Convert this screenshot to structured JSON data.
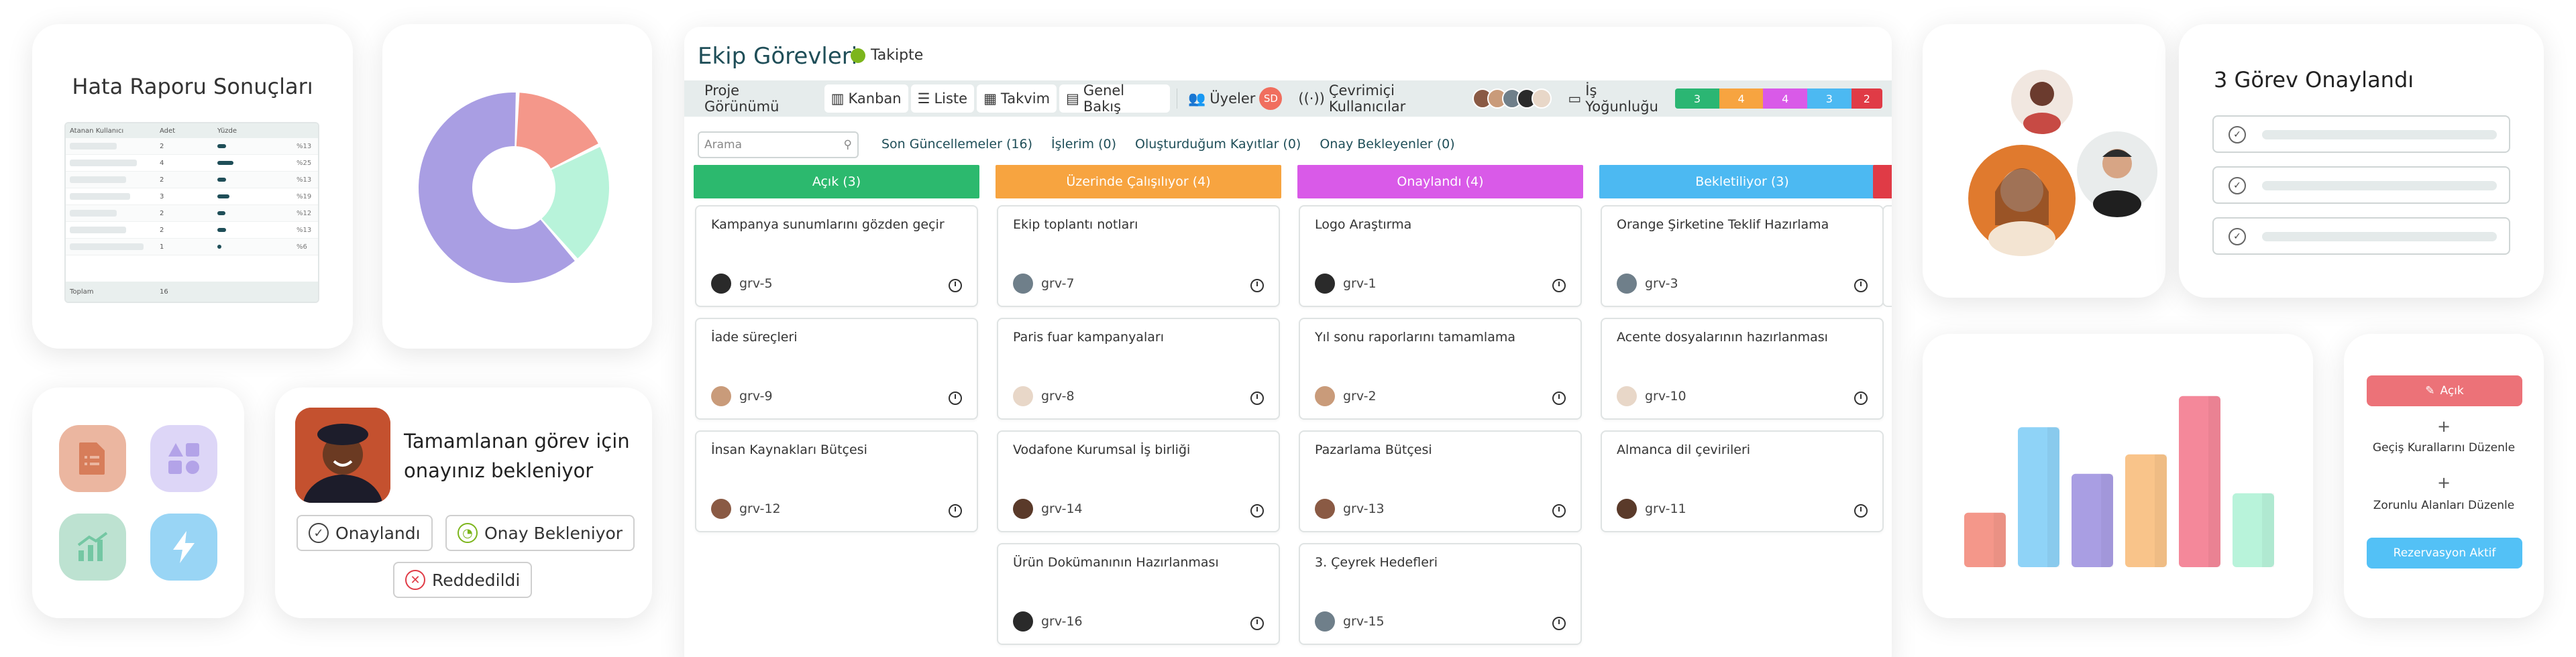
{
  "report": {
    "title": "Hata Raporu Sonuçları",
    "headers": [
      "Atanan Kullanıcı",
      "Adet",
      "Yüzde"
    ],
    "rows": [
      {
        "count": "2",
        "pct": "%13",
        "fill": 0.13
      },
      {
        "count": "4",
        "pct": "%25",
        "fill": 0.25
      },
      {
        "count": "2",
        "pct": "%13",
        "fill": 0.13
      },
      {
        "count": "3",
        "pct": "%19",
        "fill": 0.19
      },
      {
        "count": "2",
        "pct": "%12",
        "fill": 0.12
      },
      {
        "count": "2",
        "pct": "%13",
        "fill": 0.13
      },
      {
        "count": "1",
        "pct": "%6",
        "fill": 0.06
      }
    ],
    "total_label": "Toplam",
    "total_value": "16"
  },
  "donut": {
    "colors": [
      "#a99ee3",
      "#f4978a",
      "#b8f3da"
    ],
    "values": [
      0.62,
      0.17,
      0.21
    ]
  },
  "icons": {
    "items": [
      {
        "name": "document-list-icon",
        "bg": "#ebb6a0",
        "fg": "#d77d5a"
      },
      {
        "name": "shapes-icon",
        "bg": "#ddd6f7",
        "fg": "#b3a3e8"
      },
      {
        "name": "chart-growth-icon",
        "bg": "#bde2d1",
        "fg": "#74c7a3"
      },
      {
        "name": "lightning-icon",
        "bg": "#99d5f5",
        "fg": "#4aaee8"
      }
    ]
  },
  "approval": {
    "message": "Tamamlanan görev için onayınız bekleniyor",
    "approved": "Onaylandı",
    "pending": "Onay Bekleniyor",
    "rejected": "Reddedildi"
  },
  "board": {
    "title": "Ekip Görevleri",
    "follow": "Takipte",
    "view_label": "Proje Görünümü",
    "views": [
      "Kanban",
      "Liste",
      "Takvim",
      "Genel Bakış"
    ],
    "members_label": "Üyeler",
    "members_initials": "SD",
    "online_label": "Çevrimiçi Kullanıcılar",
    "load_label": "İş Yoğunluğu",
    "load": [
      {
        "value": "3",
        "color": "#2bb673"
      },
      {
        "value": "4",
        "color": "#f7a440"
      },
      {
        "value": "4",
        "color": "#d95ae8"
      },
      {
        "value": "3",
        "color": "#4cb9f2"
      },
      {
        "value": "2",
        "color": "#e03b46"
      }
    ],
    "search_placeholder": "Arama",
    "filters": [
      "Son Güncellemeler (16)",
      "İşlerim (0)",
      "Oluşturduğum Kayıtlar (0)",
      "Onay Bekleyenler (0)"
    ],
    "columns": [
      {
        "title": "Açık (3)",
        "color": "#2cb96e",
        "tasks": [
          {
            "title": "Kampanya sunumlarını gözden geçir",
            "id": "grv-5"
          },
          {
            "title": "İade süreçleri",
            "id": "grv-9"
          },
          {
            "title": "İnsan Kaynakları Bütçesi",
            "id": "grv-12"
          }
        ]
      },
      {
        "title": "Üzerinde Çalışılıyor (4)",
        "color": "#f7a440",
        "tasks": [
          {
            "title": "Ekip toplantı notları",
            "id": "grv-7"
          },
          {
            "title": "Paris fuar kampanyaları",
            "id": "grv-8"
          },
          {
            "title": "Vodafone Kurumsal İş birliği",
            "id": "grv-14"
          },
          {
            "title": "Ürün Dokümanının Hazırlanması",
            "id": "grv-16"
          }
        ]
      },
      {
        "title": "Onaylandı (4)",
        "color": "#d95ae8",
        "tasks": [
          {
            "title": "Logo Araştırma",
            "id": "grv-1"
          },
          {
            "title": "Yıl sonu raporlarını tamamlama",
            "id": "grv-2"
          },
          {
            "title": "Pazarlama Bütçesi",
            "id": "grv-13"
          },
          {
            "title": "3. Çeyrek Hedefleri",
            "id": "grv-15"
          }
        ]
      },
      {
        "title": "Bekletiliyor (3)",
        "color": "#4cb9f2",
        "tasks": [
          {
            "title": "Orange Şirketine Teklif Hazırlama",
            "id": "grv-3"
          },
          {
            "title": "Acente dosyalarının hazırlanması",
            "id": "grv-10"
          },
          {
            "title": "Almanca dil çevirileri",
            "id": "grv-11"
          }
        ]
      }
    ]
  },
  "approved_card": {
    "title": "3 Görev Onaylandı"
  },
  "bar_chart": {
    "type": "bar",
    "values": [
      0.28,
      0.72,
      0.48,
      0.58,
      0.88,
      0.38
    ],
    "colors": [
      "#f4978a",
      "#8fd3f7",
      "#a99ee3",
      "#f9c48a",
      "#f4889a",
      "#b8f3da"
    ]
  },
  "status": {
    "open_label": "Açık",
    "transition_rules": "Geçiş Kurallarını Düzenle",
    "required_fields": "Zorunlu Alanları Düzenle",
    "reservation": "Rezervasyon Aktif"
  }
}
